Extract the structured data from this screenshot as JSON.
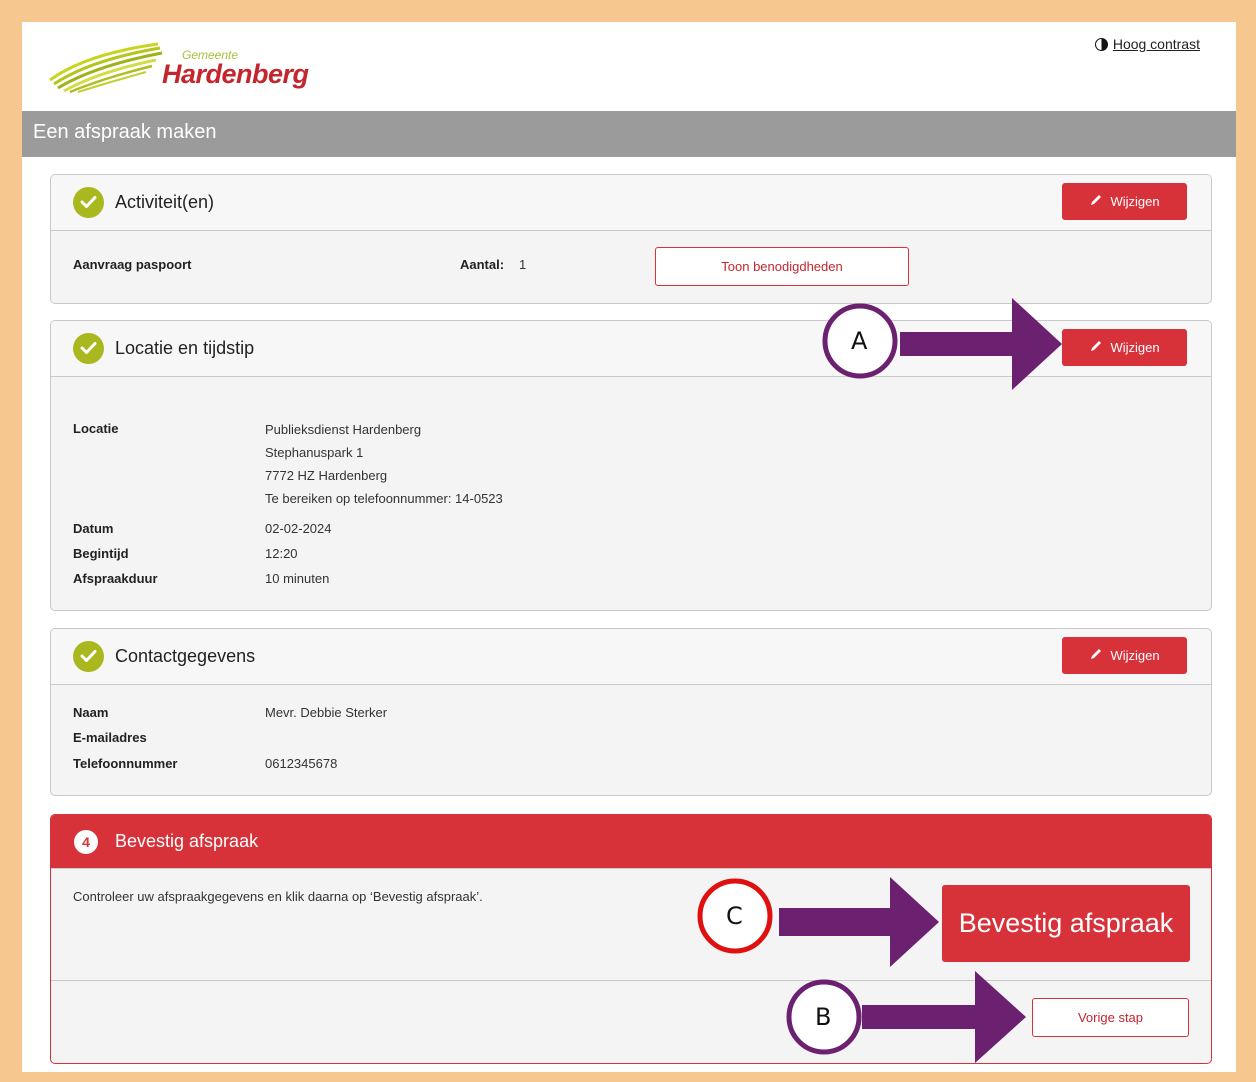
{
  "header": {
    "logo_small": "Gemeente",
    "logo_name": "Hardenberg",
    "contrast_label": "Hoog contrast"
  },
  "page_title": "Een afspraak maken",
  "sections": {
    "activities": {
      "title": "Activiteit(en)",
      "edit_label": "Wijzigen",
      "item": "Aanvraag paspoort",
      "count_label": "Aantal:",
      "count_value": "1",
      "show_button": "Toon benodigdheden"
    },
    "location": {
      "title": "Locatie en tijdstip",
      "edit_label": "Wijzigen",
      "location_label": "Locatie",
      "location_lines": [
        "Publieksdienst Hardenberg",
        "Stephanuspark 1",
        "7772 HZ Hardenberg",
        "Te bereiken op telefoonnummer: 14-0523"
      ],
      "date_label": "Datum",
      "date_value": "02-02-2024",
      "start_label": "Begintijd",
      "start_value": "12:20",
      "duration_label": "Afspraakduur",
      "duration_value": "10 minuten"
    },
    "contact": {
      "title": "Contactgegevens",
      "edit_label": "Wijzigen",
      "name_label": "Naam",
      "name_value": "Mevr. Debbie Sterker",
      "email_label": "E-mailadres",
      "phone_label": "Telefoonnummer",
      "phone_value": "0612345678"
    },
    "confirm": {
      "step": "4",
      "title": "Bevestig afspraak",
      "instruction": "Controleer uw afspraakgegevens en klik daarna op ‘Bevestig afspraak’.",
      "confirm_button": "Bevestig afspraak",
      "previous_button": "Vorige stap"
    }
  },
  "annotations": {
    "a": "A",
    "b": "B",
    "c": "C",
    "arrow_color": "#6b2170",
    "circle_a_color": "#6b2170",
    "circle_b_color": "#6b2170",
    "circle_c_color": "#e01010"
  },
  "colors": {
    "brand_red": "#d7323a",
    "check_green": "#a8b81e",
    "title_bar": "#9b9b9b",
    "page_border": "#f6c88f"
  }
}
